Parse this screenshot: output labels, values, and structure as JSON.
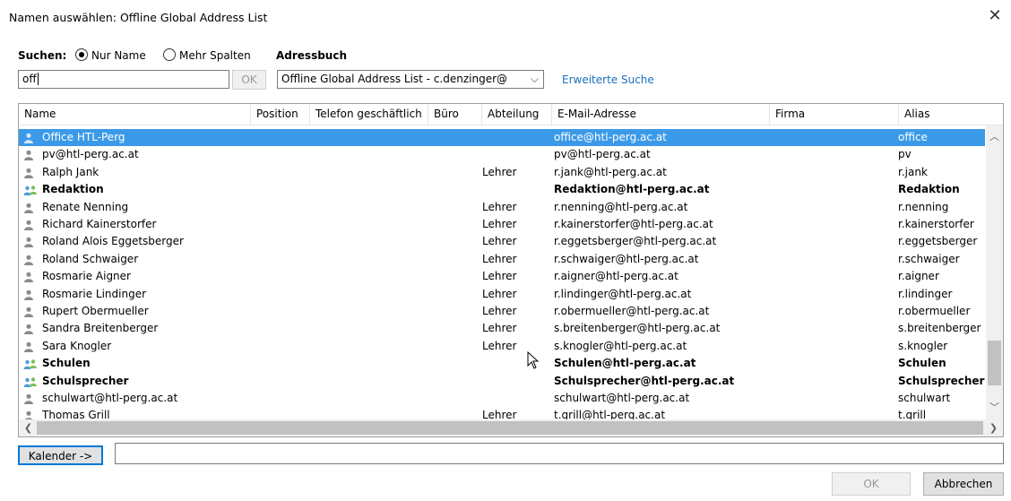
{
  "window": {
    "title": "Namen auswählen: Offline Global Address List",
    "close_icon": "close-icon"
  },
  "search": {
    "label": "Suchen:",
    "option_name": "Nur Name",
    "option_columns": "Mehr Spalten",
    "selected": "Nur Name",
    "value": "off",
    "ok_label": "OK"
  },
  "addressbook": {
    "label": "Adressbuch",
    "selected": "Offline Global Address List - c.denzinger@",
    "advanced_label": "Erweiterte Suche"
  },
  "table": {
    "columns": [
      "Name",
      "Position",
      "Telefon geschäftlich",
      "Büro",
      "Abteilung",
      "E-Mail-Adresse",
      "Firma",
      "Alias"
    ],
    "rows": [
      {
        "type": "person",
        "bold": false,
        "selected": true,
        "name": "Office HTL-Perg",
        "abteilung": "",
        "email": "office@htl-perg.ac.at",
        "alias": "office"
      },
      {
        "type": "person",
        "bold": false,
        "selected": false,
        "name": "pv@htl-perg.ac.at",
        "abteilung": "",
        "email": "pv@htl-perg.ac.at",
        "alias": "pv"
      },
      {
        "type": "person",
        "bold": false,
        "selected": false,
        "name": "Ralph Jank",
        "abteilung": "Lehrer",
        "email": "r.jank@htl-perg.ac.at",
        "alias": "r.jank"
      },
      {
        "type": "group",
        "bold": true,
        "selected": false,
        "name": "Redaktion",
        "abteilung": "",
        "email": "Redaktion@htl-perg.ac.at",
        "alias": "Redaktion"
      },
      {
        "type": "person",
        "bold": false,
        "selected": false,
        "name": "Renate Nenning",
        "abteilung": "Lehrer",
        "email": "r.nenning@htl-perg.ac.at",
        "alias": "r.nenning"
      },
      {
        "type": "person",
        "bold": false,
        "selected": false,
        "name": "Richard Kainerstorfer",
        "abteilung": "Lehrer",
        "email": "r.kainerstorfer@htl-perg.ac.at",
        "alias": "r.kainerstorfer"
      },
      {
        "type": "person",
        "bold": false,
        "selected": false,
        "name": "Roland Alois Eggetsberger",
        "abteilung": "Lehrer",
        "email": "r.eggetsberger@htl-perg.ac.at",
        "alias": "r.eggetsberger"
      },
      {
        "type": "person",
        "bold": false,
        "selected": false,
        "name": "Roland Schwaiger",
        "abteilung": "Lehrer",
        "email": "r.schwaiger@htl-perg.ac.at",
        "alias": "r.schwaiger"
      },
      {
        "type": "person",
        "bold": false,
        "selected": false,
        "name": "Rosmarie Aigner",
        "abteilung": "Lehrer",
        "email": "r.aigner@htl-perg.ac.at",
        "alias": "r.aigner"
      },
      {
        "type": "person",
        "bold": false,
        "selected": false,
        "name": "Rosmarie Lindinger",
        "abteilung": "Lehrer",
        "email": "r.lindinger@htl-perg.ac.at",
        "alias": "r.lindinger"
      },
      {
        "type": "person",
        "bold": false,
        "selected": false,
        "name": "Rupert Obermueller",
        "abteilung": "Lehrer",
        "email": "r.obermueller@htl-perg.ac.at",
        "alias": "r.obermueller"
      },
      {
        "type": "person",
        "bold": false,
        "selected": false,
        "name": "Sandra Breitenberger",
        "abteilung": "Lehrer",
        "email": "s.breitenberger@htl-perg.ac.at",
        "alias": "s.breitenberger"
      },
      {
        "type": "person",
        "bold": false,
        "selected": false,
        "name": "Sara Knogler",
        "abteilung": "Lehrer",
        "email": "s.knogler@htl-perg.ac.at",
        "alias": "s.knogler"
      },
      {
        "type": "group",
        "bold": true,
        "selected": false,
        "name": "Schulen",
        "abteilung": "",
        "email": "Schulen@htl-perg.ac.at",
        "alias": "Schulen"
      },
      {
        "type": "group",
        "bold": true,
        "selected": false,
        "name": "Schulsprecher",
        "abteilung": "",
        "email": "Schulsprecher@htl-perg.ac.at",
        "alias": "Schulsprecher"
      },
      {
        "type": "person",
        "bold": false,
        "selected": false,
        "name": "schulwart@htl-perg.ac.at",
        "abteilung": "",
        "email": "schulwart@htl-perg.ac.at",
        "alias": "schulwart"
      },
      {
        "type": "person",
        "bold": false,
        "selected": false,
        "name": "Thomas Grill",
        "abteilung": "Lehrer",
        "email": "t.grill@htl-perg.ac.at",
        "alias": "t.grill"
      }
    ]
  },
  "footer": {
    "calendar_label": "Kalender ->",
    "calendar_value": "",
    "ok_label": "OK",
    "cancel_label": "Abbrechen"
  },
  "colors": {
    "selection": "#3b9ae8",
    "link": "#1a6fc0",
    "person_icon": "#8a8a8a",
    "group_icon": "#4a9fd8"
  }
}
